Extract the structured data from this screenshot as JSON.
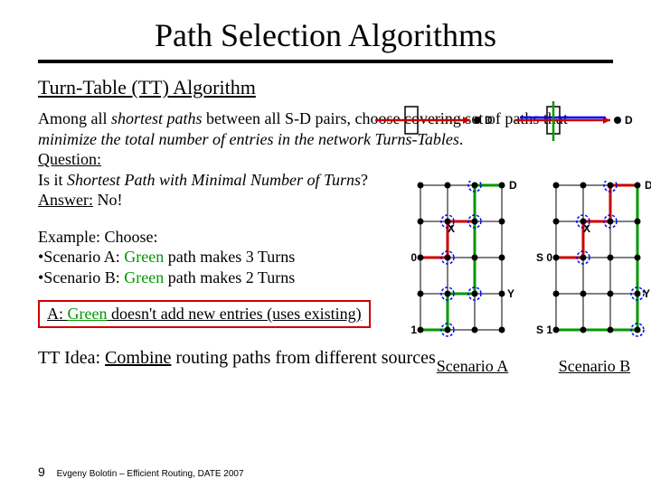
{
  "title": "Path Selection Algorithms",
  "subtitle": "Turn-Table (TT) Algorithm",
  "para1a": "Among all ",
  "para1b": "shortest paths",
  "para1c": " between all S-D pairs, choose covering set of paths that ",
  "para1d": "minimize the total number of entries in the network Turns-Tables",
  "para1e": ".",
  "question_label": "Question:",
  "question_text": "Is it ",
  "question_italic": "Shortest Path with Minimal Number of Turns",
  "question_tail": "?",
  "answer_label": "Answer:",
  "answer_text": " No!",
  "example_head": "Example: Choose:",
  "bulletA_a": "•Scenario A: ",
  "bulletA_b": "Green",
  "bulletA_c": " path makes 3 Turns",
  "bulletB_a": "•Scenario B: ",
  "bulletB_b": "Green",
  "bulletB_c": " path makes 2 Turns",
  "highlight_a": "A: ",
  "highlight_b": "Green",
  "highlight_c": " doesn't add new entries (uses existing)",
  "tt_idea_a": "TT Idea: ",
  "tt_idea_b": "Combine",
  "tt_idea_c": " routing paths from different sources",
  "footer_num": "9",
  "footer_text": "Evgeny Bolotin – Efficient Routing, DATE 2007",
  "scenarioA": "Scenario A",
  "scenarioB": "Scenario B",
  "labels": {
    "D": "D",
    "X": "X",
    "Y": "Y",
    "S0": "S 0",
    "S1": "S 1"
  },
  "colors": {
    "green": "#090",
    "red": "#c00",
    "blue": "#00f"
  }
}
